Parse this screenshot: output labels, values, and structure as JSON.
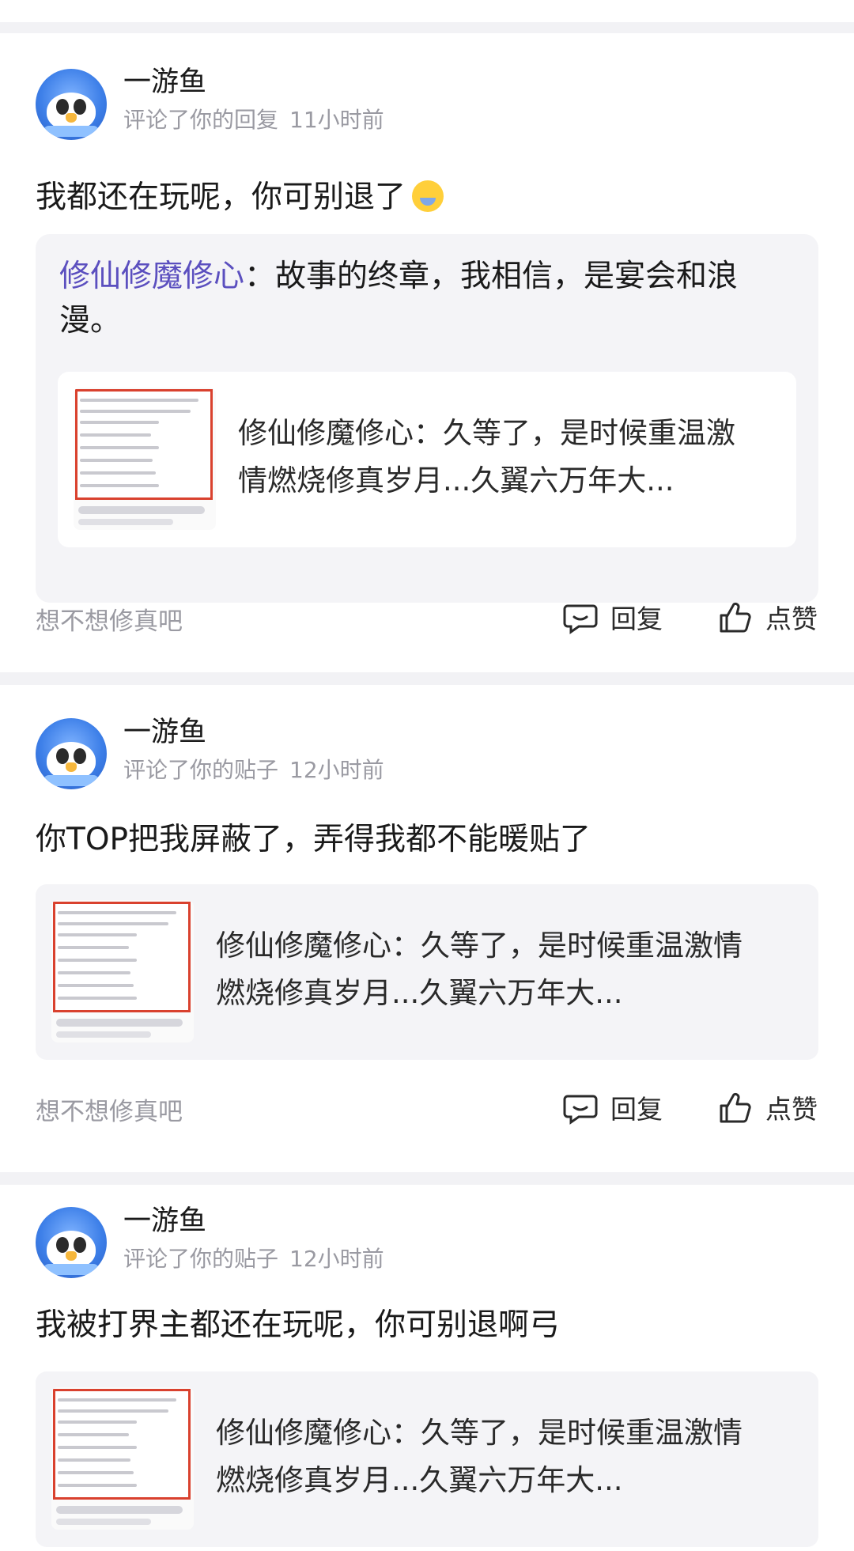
{
  "notifications": [
    {
      "username": "一游鱼",
      "action": "评论了你的回复",
      "time": "11小时前",
      "comment": "我都还在玩呢，你可别退了",
      "quote": {
        "author": "修仙修魔修心",
        "separator": "：",
        "text": "故事的终章，我相信，是宴会和浪漫。"
      },
      "post": {
        "line1": "修仙修魔修心：久等了，是时候重温激",
        "line2": "情燃烧修真岁月...久翼六万年大..."
      },
      "tag": "想不想修真吧",
      "reply_label": "回复",
      "like_label": "点赞"
    },
    {
      "username": "一游鱼",
      "action": "评论了你的贴子",
      "time": "12小时前",
      "comment": "你TOP把我屏蔽了，弄得我都不能暖贴了",
      "post": {
        "line1": "修仙修魔修心：久等了，是时候重温激情",
        "line2": "燃烧修真岁月...久翼六万年大..."
      },
      "tag": "想不想修真吧",
      "reply_label": "回复",
      "like_label": "点赞"
    },
    {
      "username": "一游鱼",
      "action": "评论了你的贴子",
      "time": "12小时前",
      "comment": "我被打界主都还在玩呢，你可别退啊弓",
      "post": {
        "line1": "修仙修魔修心：久等了，是时候重温激情",
        "line2": "燃烧修真岁月...久翼六万年大..."
      }
    }
  ],
  "icons": {
    "emoji": "yawning-face-emoji",
    "reply": "chat-bubble-icon",
    "like": "thumbs-up-icon"
  },
  "colors": {
    "quote_author": "#5b4fbf",
    "thumb_border": "#d9412e",
    "meta": "#9a9aa2"
  }
}
